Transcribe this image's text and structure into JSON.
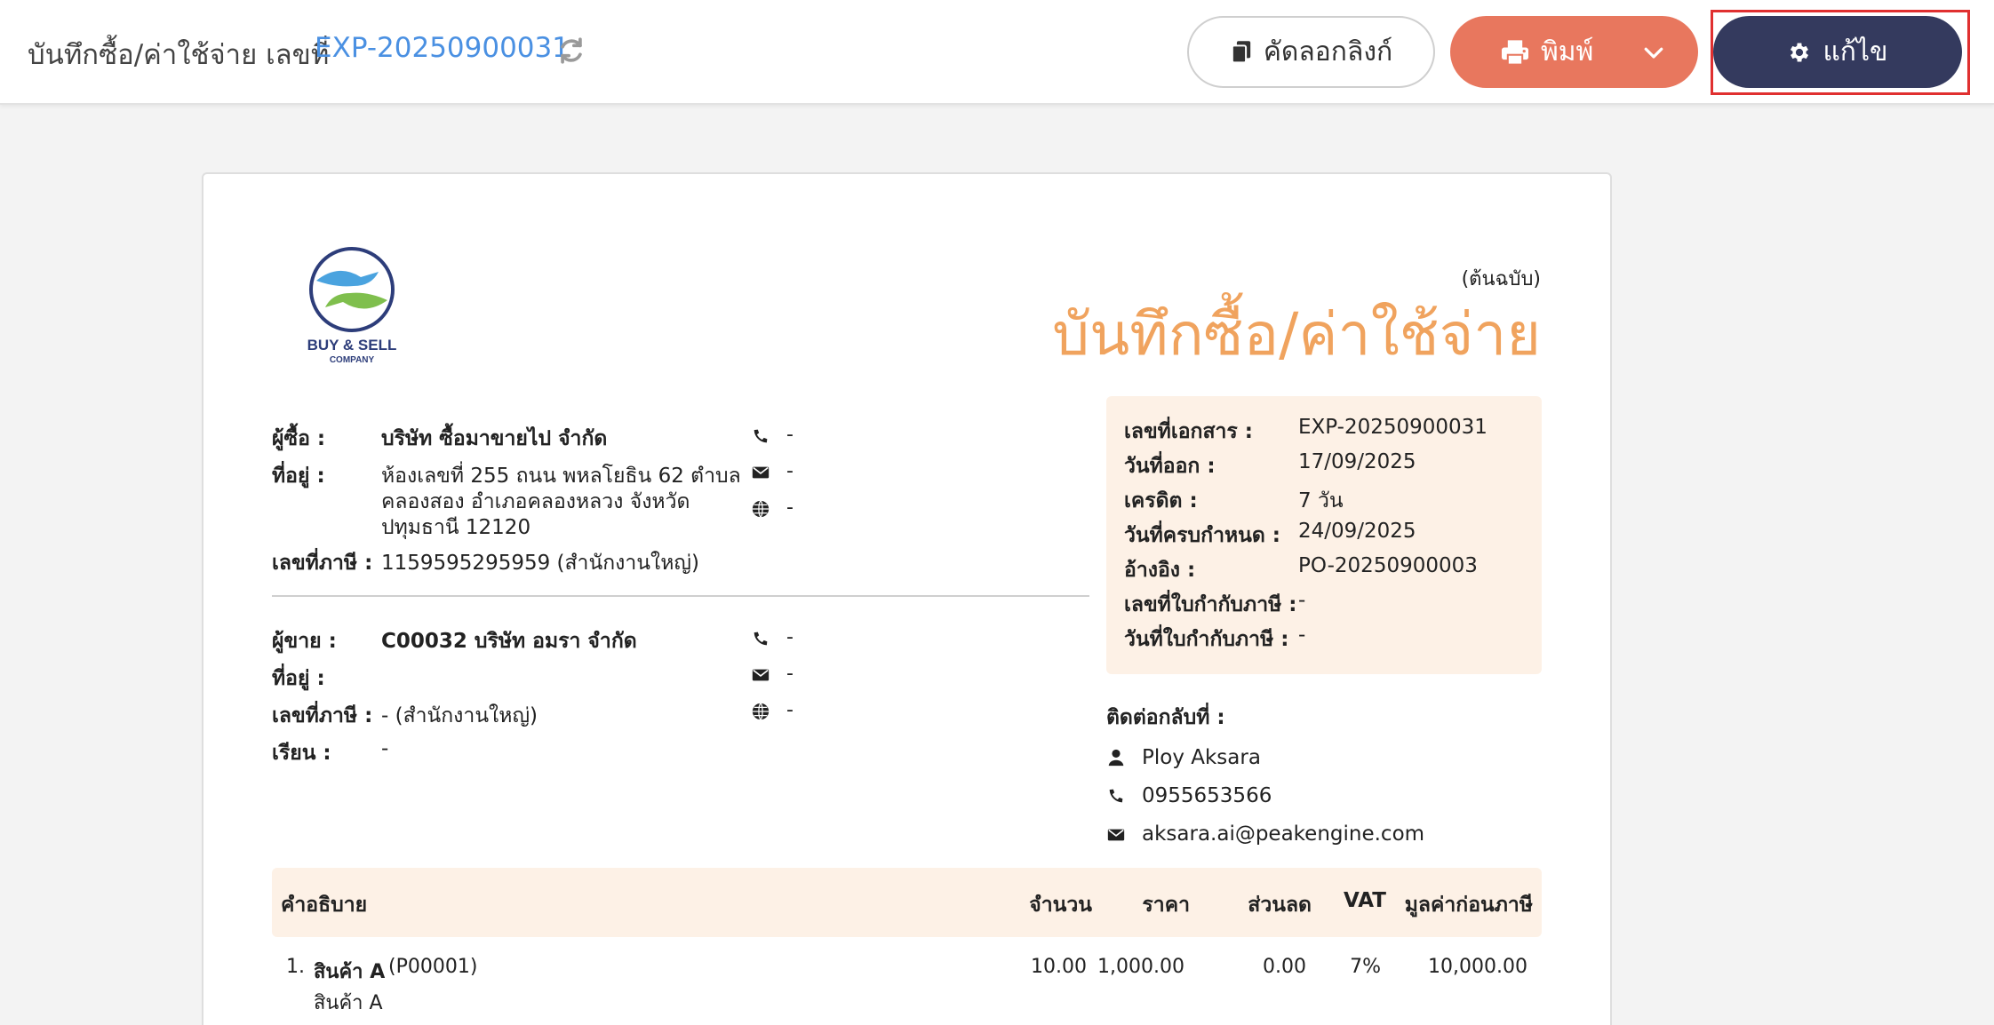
{
  "topbar": {
    "title": "บันทึกซื้อ/ค่าใช้จ่าย เลขที่",
    "doc_no": "EXP-20250900031",
    "copy_label": "คัดลอกลิงก์",
    "print_label": "พิมพ์",
    "edit_label": "แก้ไข"
  },
  "doc": {
    "original_label": "(ต้นฉบับ)",
    "title": "บันทึกซื้อ/ค่าใช้จ่าย",
    "logo_text": "BUY & SELL",
    "logo_sub": "COMPANY",
    "buyer": {
      "name_label": "ผู้ซื้อ :",
      "name": "บริษัท ซื้อมาขายไป จำกัด",
      "address_label": "ที่อยู่ :",
      "address_lines": [
        "ห้องเลขที่ 255 ถนน พหลโยธิน 62 ตำบล",
        "คลองสอง อำเภอคลองหลวง จังหวัด",
        "ปทุมธานี 12120"
      ],
      "tax_label": "เลขที่ภาษี :",
      "tax": "1159595295959 (สำนักงานใหญ่)",
      "phone": "-",
      "email": "-",
      "web": "-"
    },
    "seller": {
      "name_label": "ผู้ขาย :",
      "name": "C00032 บริษัท อมรา จำกัด",
      "address_label": "ที่อยู่ :",
      "tax_label": "เลขที่ภาษี :",
      "tax": "- (สำนักงานใหญ่)",
      "attn_label": "เรียน :",
      "attn": "-",
      "phone": "-",
      "email": "-",
      "web": "-"
    },
    "info": {
      "rows": [
        {
          "label": "เลขที่เอกสาร :",
          "value": "EXP-20250900031"
        },
        {
          "label": "วันที่ออก :",
          "value": "17/09/2025"
        },
        {
          "label": "เครดิต :",
          "value": "7 วัน"
        },
        {
          "label": "วันที่ครบกำหนด :",
          "value": "24/09/2025"
        },
        {
          "label": "อ้างอิง :",
          "value": "PO-20250900003"
        },
        {
          "label": "เลขที่ใบกำกับภาษี :",
          "value": "-"
        },
        {
          "label": "วันที่ใบกำกับภาษี :",
          "value": "-"
        }
      ]
    },
    "contact": {
      "title": "ติดต่อกลับที่ :",
      "name": "Ploy Aksara",
      "phone": "0955653566",
      "email": "aksara.ai@peakengine.com"
    },
    "table": {
      "headers": [
        "คำอธิบาย",
        "จำนวน",
        "ราคา",
        "ส่วนลด",
        "VAT",
        "มูลค่าก่อนภาษี"
      ],
      "rows": [
        {
          "no": "1.",
          "name": "สินค้า A",
          "code": "(P00001)",
          "desc": "สินค้า A",
          "qty": "10.00",
          "price": "1,000.00",
          "discount": "0.00",
          "vat": "7%",
          "amount": "10,000.00"
        }
      ]
    }
  },
  "colors": {
    "accent_orange": "#f0a35e",
    "print_button": "#e8775e",
    "edit_button": "#343a5e",
    "doc_no_blue": "#4a90e2",
    "highlight_box": "#e03030",
    "panel_bg": "#fdf1e6"
  }
}
